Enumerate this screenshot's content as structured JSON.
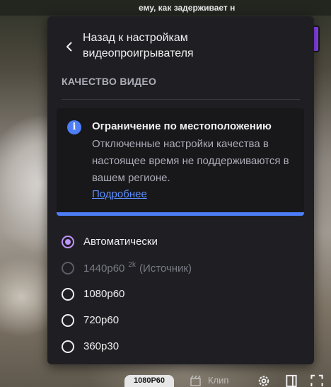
{
  "background": {
    "chat_snippet": "ему, как задерживает н"
  },
  "settings": {
    "back_label": "Назад к настройкам видеопроигрывателя",
    "section_title": "КАЧЕСТВО ВИДЕО",
    "notice": {
      "title": "Ограничение по местоположению",
      "body": "Отключенные настройки качества в настоящее время не поддерживаются в вашем регионе.",
      "link": "Подробнее",
      "accent_color": "#4d7ef7"
    },
    "options": [
      {
        "label": "Автоматически",
        "selected": true,
        "disabled": false
      },
      {
        "label": "1440p60",
        "badge": "2k",
        "suffix": "(Источник)",
        "selected": false,
        "disabled": true
      },
      {
        "label": "1080p60",
        "selected": false,
        "disabled": false
      },
      {
        "label": "720p60",
        "selected": false,
        "disabled": false
      },
      {
        "label": "360p30",
        "selected": false,
        "disabled": false
      }
    ]
  },
  "player_bar": {
    "quality_badge": "1080P60",
    "clip_label": "Клип",
    "icons": [
      "settings-gear-icon",
      "theatre-mode-icon",
      "fullscreen-icon"
    ]
  },
  "colors": {
    "panel_bg": "#1f1f23",
    "radio_selected": "#bf94ff",
    "link": "#5c8dfb"
  }
}
